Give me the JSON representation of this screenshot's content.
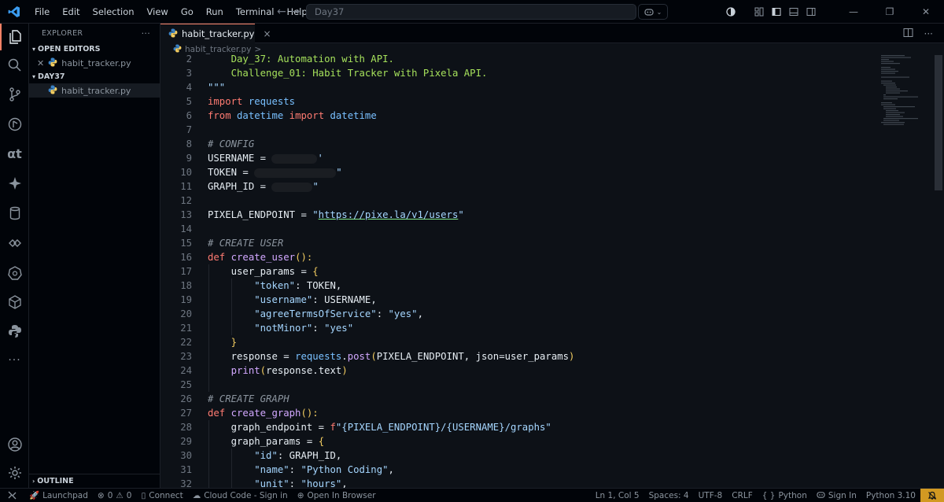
{
  "titlebar": {
    "menu": [
      "File",
      "Edit",
      "Selection",
      "View",
      "Go",
      "Run",
      "Terminal",
      "Help"
    ],
    "search_text": "Day37"
  },
  "sidebar": {
    "header": "EXPLORER",
    "more": "···",
    "open_editors_label": "OPEN EDITORS",
    "open_editor_file": "habit_tracker.py",
    "folder_label": "DAY37",
    "folder_file": "habit_tracker.py",
    "outline_label": "OUTLINE"
  },
  "tab": {
    "label": "habit_tracker.py",
    "close": "×"
  },
  "breadcrumb": {
    "file": "habit_tracker.py",
    "sep": ">"
  },
  "code": {
    "line_numbers": [
      "2",
      "3",
      "4",
      "5",
      "6",
      "7",
      "8",
      "9",
      "10",
      "11",
      "12",
      "13",
      "14",
      "15",
      "16",
      "17",
      "18",
      "19",
      "20",
      "21",
      "22",
      "23",
      "24",
      "25",
      "26",
      "27",
      "28",
      "29",
      "30",
      "31",
      "32"
    ],
    "l2": "Day_37: Automation with API.",
    "l3": "Challenge_01: Habit Tracker with Pixela API.",
    "l4": "\"\"\"",
    "l5_kw": "import",
    "l5_mod": "requests",
    "l6_kw1": "from",
    "l6_mod1": "datetime",
    "l6_kw2": "import",
    "l6_mod2": "datetime",
    "l8": "# CONFIG",
    "l9": "USERNAME = ",
    "l9_end": "'",
    "l10": "TOKEN = ",
    "l10_end": "\"",
    "l11": "GRAPH_ID = ",
    "l11_end": "\"",
    "l13_a": "PIXELA_ENDPOINT = ",
    "l13_q1": "\"",
    "l13_url": "https://pixe.la/v1/users",
    "l13_q2": "\"",
    "l15": "# CREATE USER",
    "l16_kw": "def",
    "l16_fn": "create_user",
    "l16_p": "():",
    "l17_a": "user_params = ",
    "l17_b": "{",
    "l18_k": "\"token\"",
    "l18_v": ": TOKEN,",
    "l19_k": "\"username\"",
    "l19_v": ": USERNAME,",
    "l20_k": "\"agreeTermsOfService\"",
    "l20_c": ": ",
    "l20_v": "\"yes\"",
    "l20_e": ",",
    "l21_k": "\"notMinor\"",
    "l21_c": ": ",
    "l21_v": "\"yes\"",
    "l22": "}",
    "l23_a": "response = ",
    "l23_mod": "requests",
    "l23_dot": ".",
    "l23_fn": "post",
    "l23_p1": "(",
    "l23_b": "PIXELA_ENDPOINT, json=user_params",
    "l23_p2": ")",
    "l24_fn": "print",
    "l24_p1": "(",
    "l24_b": "response.text",
    "l24_p2": ")",
    "l26": "# CREATE GRAPH",
    "l27_kw": "def",
    "l27_fn": "create_graph",
    "l27_p": "():",
    "l28_a": "graph_endpoint = ",
    "l28_f": "f",
    "l28_s": "\"{PIXELA_ENDPOINT}/{USERNAME}/graphs\"",
    "l29_a": "graph_params = ",
    "l29_b": "{",
    "l30_k": "\"id\"",
    "l30_v": ": GRAPH_ID,",
    "l31_k": "\"name\"",
    "l31_c": ": ",
    "l31_v": "\"Python Coding\"",
    "l31_e": ",",
    "l32_k": "\"unit\"",
    "l32_c": ": ",
    "l32_v": "\"hours\"",
    "l32_e": ","
  },
  "statusbar": {
    "launchpad": "Launchpad",
    "errors": "0",
    "warnings": "0",
    "connect": "Connect",
    "cloud_code": "Cloud Code - Sign in",
    "open_browser": "Open In Browser",
    "position": "Ln 1, Col 5",
    "spaces": "Spaces: 4",
    "encoding": "UTF-8",
    "eol": "CRLF",
    "braces": "{ }",
    "language": "Python",
    "sign_in": "Sign In",
    "interpreter": "Python 3.10"
  },
  "colors": {
    "accent": "#f78166",
    "bell": "#d29922",
    "background": "#0d1117"
  }
}
